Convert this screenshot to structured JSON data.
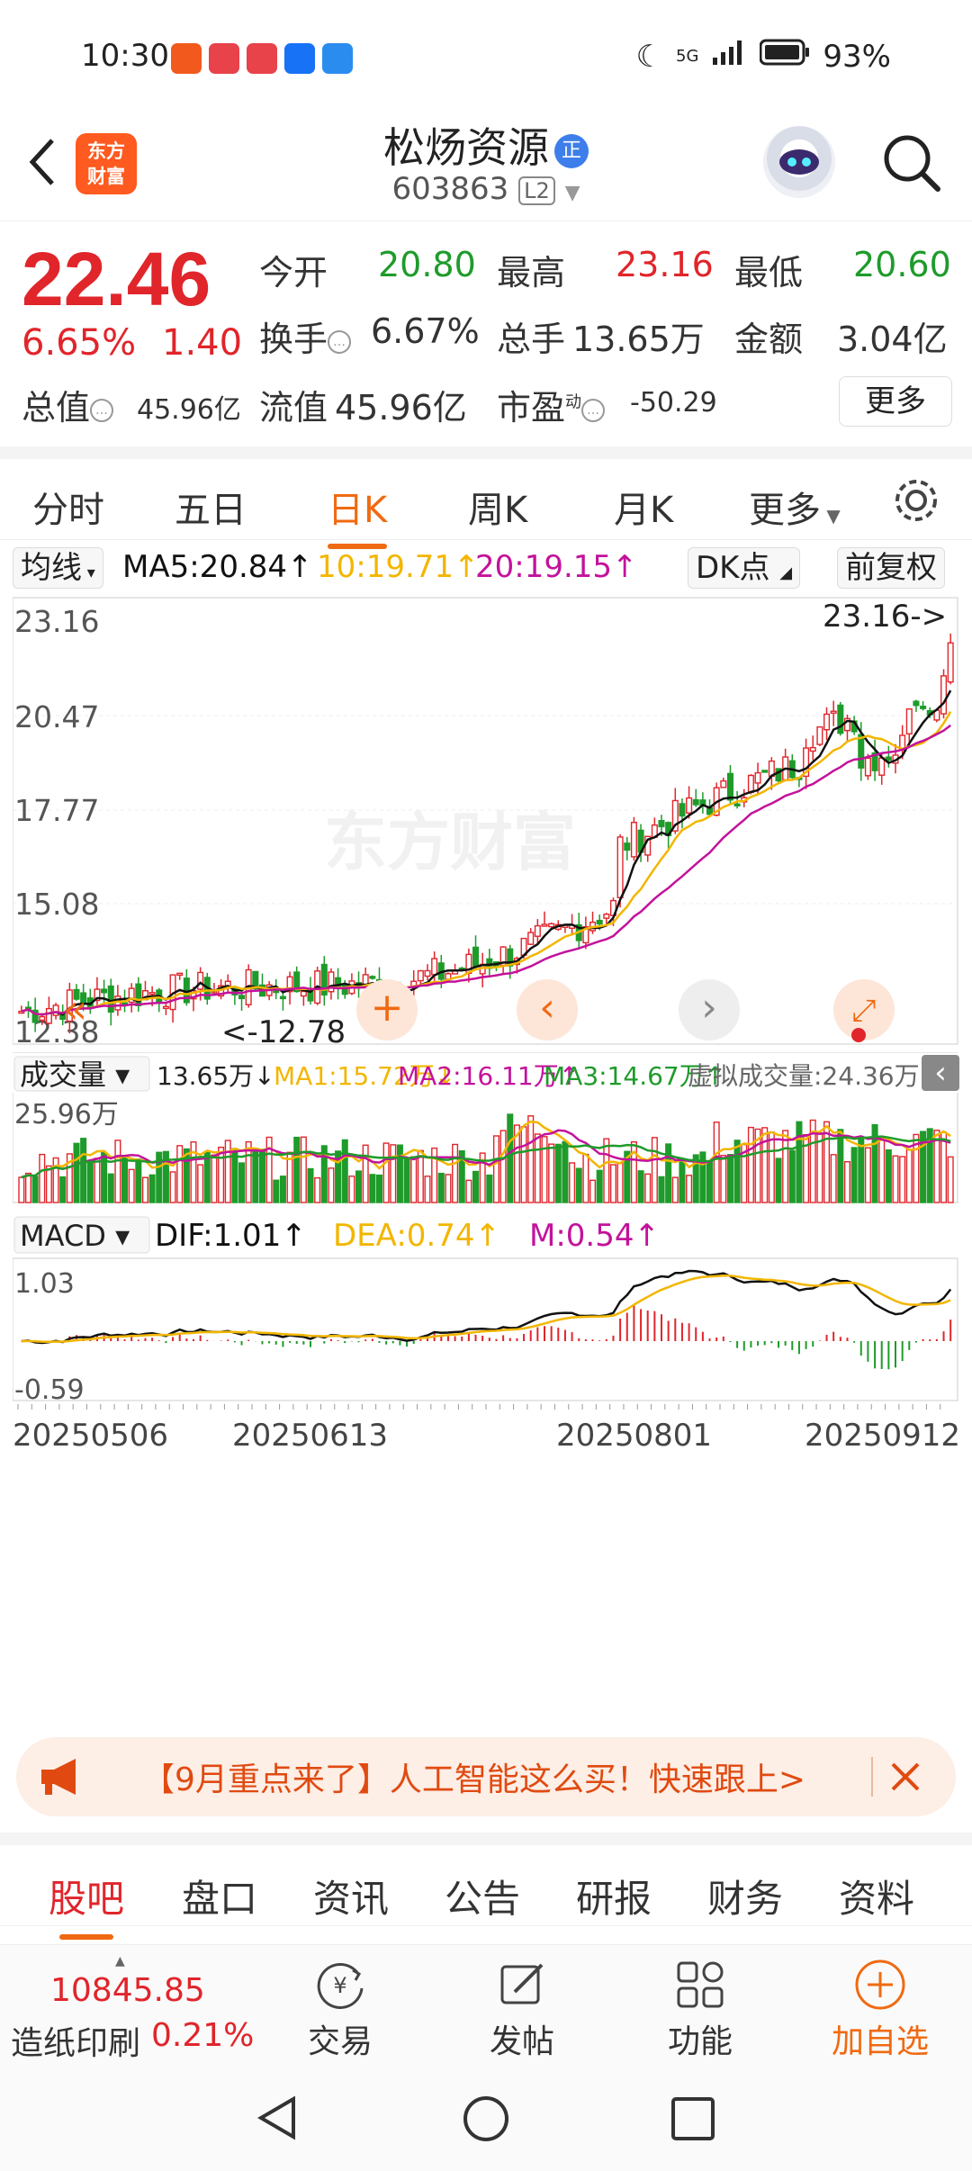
{
  "status": {
    "time": "10:30",
    "network": "5G",
    "battery": "93%"
  },
  "header": {
    "logo_line1": "东方",
    "logo_line2": "财富",
    "stock_name": "松炀资源",
    "reg_badge": "正",
    "code": "603863",
    "level": "L2"
  },
  "quote": {
    "price": "22.46",
    "change_pct": "6.65%",
    "change_amt": "1.40",
    "open_label": "今开",
    "open": "20.80",
    "high_label": "最高",
    "high": "23.16",
    "low_label": "最低",
    "low": "20.60",
    "turnover_label": "换手",
    "turnover": "6.67%",
    "volume_label": "总手",
    "volume": "13.65万",
    "amount_label": "金额",
    "amount": "3.04亿",
    "mktcap_label": "总值",
    "mktcap": "45.96亿",
    "float_label": "流值",
    "float": "45.96亿",
    "pe_label": "市盈",
    "pe_sup": "动",
    "pe": "-50.29",
    "more": "更多"
  },
  "ktabs": [
    "分时",
    "五日",
    "日K",
    "周K",
    "月K",
    "更多"
  ],
  "ma_row": {
    "selector": "均线",
    "ma5": "MA5:20.84↑",
    "ma10": "10:19.71↑",
    "ma20": "20:19.15↑",
    "dk": "DK点",
    "adjust": "前复权"
  },
  "colors": {
    "up": "#e0252b",
    "down": "#1e9b2b",
    "ma5": "#111111",
    "ma10": "#f2b600",
    "ma20": "#c3129c",
    "accent": "#f06a12"
  },
  "chart_data": {
    "type": "candlestick",
    "dates": [
      "20250506",
      "20250613",
      "20250801",
      "20250912"
    ],
    "price_axis": [
      "23.16",
      "20.47",
      "17.77",
      "15.08",
      "12.38"
    ],
    "ylim": [
      12.38,
      23.16
    ],
    "high_marker": "23.16->",
    "low_marker": "<-12.78",
    "volume": {
      "selector": "成交量",
      "current": "13.65万↓",
      "ma1": "MA1:15.72万↓",
      "ma2": "MA2:16.11万↑",
      "ma3": "MA3:14.67万↑",
      "virtual": "虚拟成交量:24.36万",
      "axis_max": "25.96万"
    },
    "macd": {
      "selector": "MACD",
      "dif": "DIF:1.01↑",
      "dea": "DEA:0.74↑",
      "m": "M:0.54↑",
      "axis_max": "1.03",
      "axis_min": "-0.59"
    },
    "watermark": "东方财富"
  },
  "banner": {
    "text": "【9月重点来了】人工智能这么买！快速跟上>"
  },
  "btabs": [
    "股吧",
    "盘口",
    "资讯",
    "公告",
    "研报",
    "财务",
    "资料"
  ],
  "toolbar": {
    "index_value": "10845.85",
    "index_name": "造纸印刷",
    "index_chg": "0.21%",
    "trade": "交易",
    "post": "发帖",
    "func": "功能",
    "watch": "加自选"
  }
}
